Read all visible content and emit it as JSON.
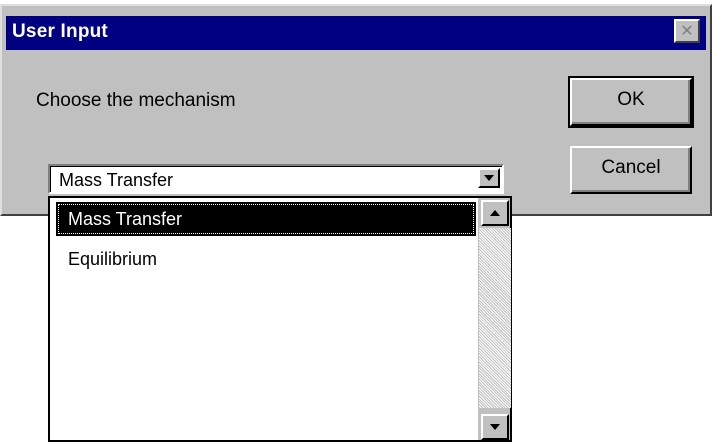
{
  "dialog": {
    "title": "User Input",
    "close_icon": "close-icon",
    "close_glyph": "✕",
    "prompt": "Choose the mechanism",
    "ok_label": "OK",
    "cancel_label": "Cancel"
  },
  "combo": {
    "selected_value": "Mass Transfer",
    "arrow_icon": "chevron-down-icon"
  },
  "dropdown": {
    "items": [
      {
        "label": "Mass Transfer",
        "selected": true
      },
      {
        "label": "Equilibrium",
        "selected": false
      }
    ]
  },
  "colors": {
    "title_bar": "#000080",
    "face": "#c0c0c0",
    "selection": "#000000"
  }
}
